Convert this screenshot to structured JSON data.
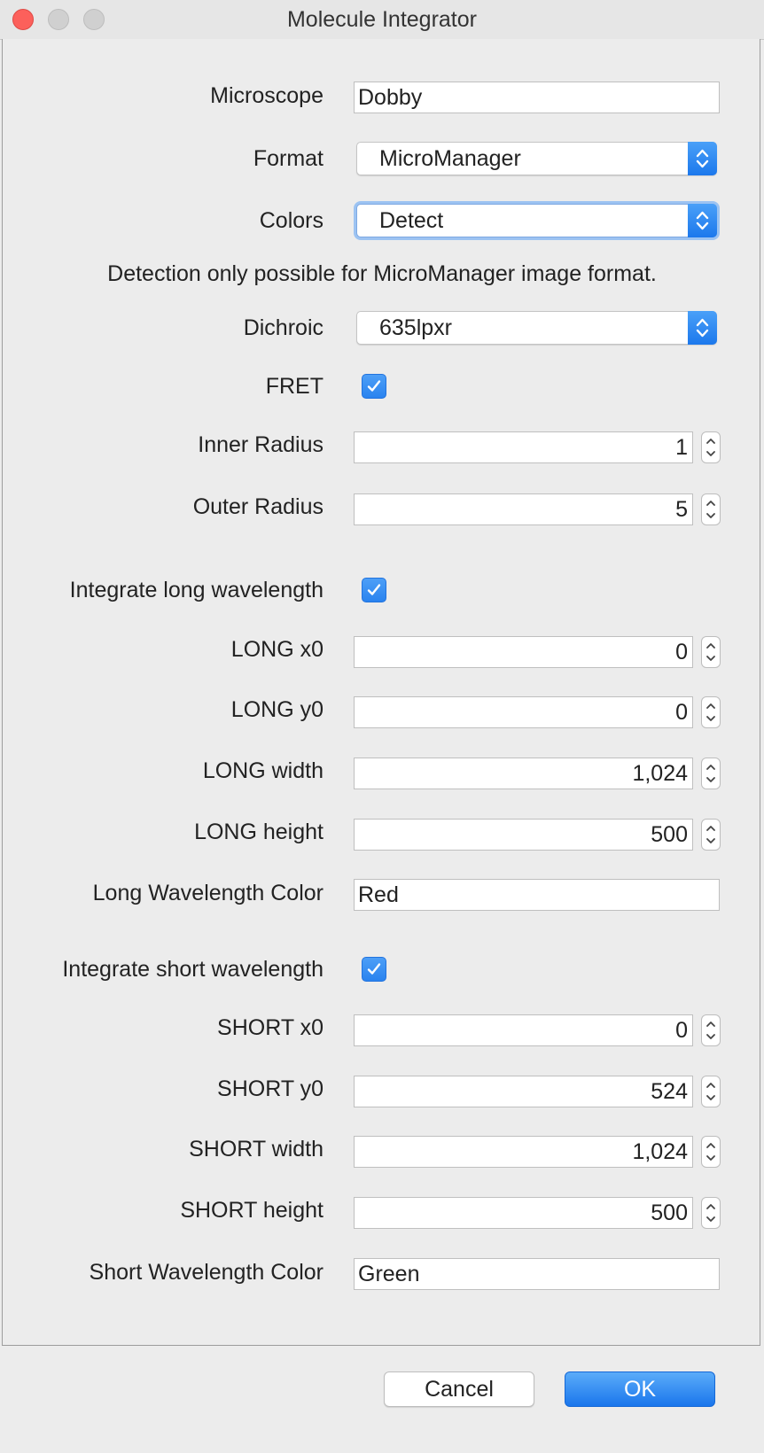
{
  "window": {
    "title": "Molecule Integrator"
  },
  "form": {
    "microscope": {
      "label": "Microscope",
      "value": "Dobby"
    },
    "format": {
      "label": "Format",
      "value": "MicroManager"
    },
    "colors": {
      "label": "Colors",
      "value": "Detect"
    },
    "detection_note": "Detection only possible for MicroManager image format.",
    "dichroic": {
      "label": "Dichroic",
      "value": "635lpxr"
    },
    "fret": {
      "label": "FRET",
      "checked": true
    },
    "inner_radius": {
      "label": "Inner Radius",
      "value": "1"
    },
    "outer_radius": {
      "label": "Outer Radius",
      "value": "5"
    },
    "integrate_long": {
      "label": "Integrate long wavelength",
      "checked": true
    },
    "long_x0": {
      "label": "LONG x0",
      "value": "0"
    },
    "long_y0": {
      "label": "LONG y0",
      "value": "0"
    },
    "long_width": {
      "label": "LONG width",
      "value": "1,024"
    },
    "long_height": {
      "label": "LONG height",
      "value": "500"
    },
    "long_color": {
      "label": "Long Wavelength Color",
      "value": "Red"
    },
    "integrate_short": {
      "label": "Integrate short wavelength",
      "checked": true
    },
    "short_x0": {
      "label": "SHORT x0",
      "value": "0"
    },
    "short_y0": {
      "label": "SHORT y0",
      "value": "524"
    },
    "short_width": {
      "label": "SHORT width",
      "value": "1,024"
    },
    "short_height": {
      "label": "SHORT height",
      "value": "500"
    },
    "short_color": {
      "label": "Short Wavelength Color",
      "value": "Green"
    }
  },
  "buttons": {
    "cancel": "Cancel",
    "ok": "OK"
  },
  "colors": {
    "accent": "#2a83ef",
    "close_light": "#fc605b",
    "background": "#ececec"
  },
  "icons": {
    "checkbox": "checkmark-icon",
    "select": "chevron-updown-icon",
    "spinner": "stepper-arrows-icon"
  }
}
